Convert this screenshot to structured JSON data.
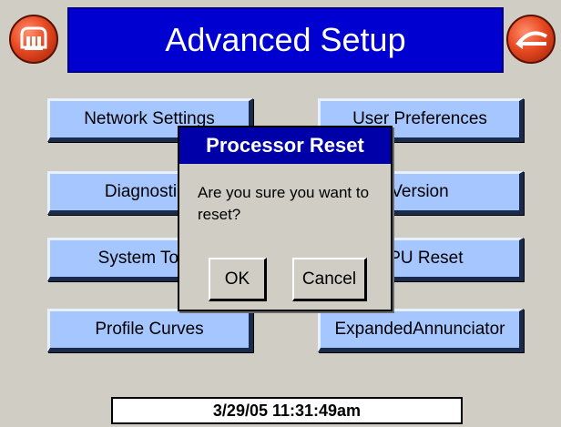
{
  "header": {
    "title": "Advanced Setup",
    "left_icon": "home-icon",
    "right_icon": "back-icon",
    "band_color": "#0000d0"
  },
  "menu": {
    "left": [
      {
        "label": "Network Settings"
      },
      {
        "label": "Diagnostics"
      },
      {
        "label": "System Tools"
      },
      {
        "label": "Profile Curves"
      }
    ],
    "right": [
      {
        "label": "User Preferences"
      },
      {
        "label": "Version"
      },
      {
        "label": "CPU Reset"
      },
      {
        "label": "ExpandedAnnunciator"
      }
    ],
    "button_color": "#a6c6ff"
  },
  "dialog": {
    "title": "Processor Reset",
    "message": "Are you sure you want to reset?",
    "ok_label": "OK",
    "cancel_label": "Cancel"
  },
  "status": {
    "datetime": "3/29/05  11:31:49am"
  }
}
